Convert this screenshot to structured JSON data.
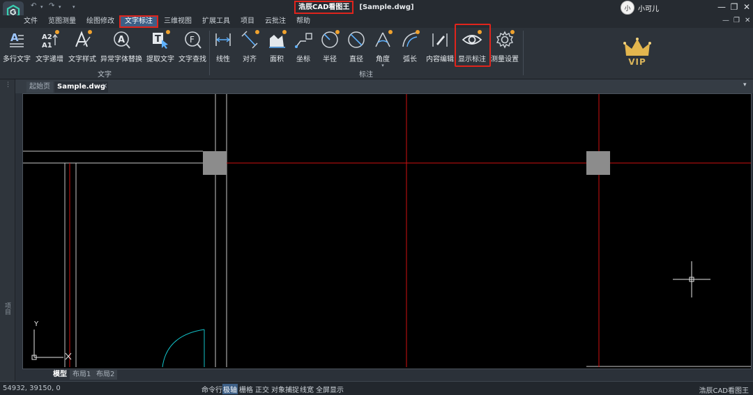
{
  "titlebar": {
    "app_title": "浩辰CAD看图王",
    "doc_title": "[Sample.dwg]",
    "user_name": "小可儿",
    "avatar_text": "小",
    "qa_undo": "↶",
    "qa_redo": "↷",
    "qa_more": "▾",
    "win_min": "—",
    "win_restore": "❐",
    "win_close": "✕"
  },
  "menu": {
    "items": [
      "文件",
      "览图测量",
      "绘图修改",
      "文字标注",
      "三维视图",
      "扩展工具",
      "项目",
      "云批注",
      "帮助"
    ],
    "sub_min": "—",
    "sub_restore": "❐",
    "sub_close": "✕"
  },
  "ribbon": {
    "text_group_label": "文字",
    "dim_group_label": "标注",
    "text_tools": [
      "多行文字",
      "文字递增",
      "文字样式",
      "异常字体替换",
      "提取文字",
      "文字查找"
    ],
    "dim_tools": [
      "线性",
      "对齐",
      "面积",
      "坐标",
      "半径",
      "直径",
      "角度",
      "弧长",
      "内容编辑",
      "显示标注",
      "测量设置"
    ],
    "vip_text": "VIP"
  },
  "tabs": {
    "home": "起始页",
    "file": "Sample.dwg",
    "close": "×",
    "expand": "▾"
  },
  "left_panel_label": "项目",
  "layouts": [
    "模型",
    "布局1",
    "布局2"
  ],
  "statusbar": {
    "coords": "54932, 39150, 0",
    "toggles": [
      "命令行",
      "极轴",
      "栅格",
      "正交",
      "对象捕捉",
      "线宽",
      "全屏显示"
    ],
    "active_toggle": "极轴",
    "brand": "浩辰CAD看图王"
  },
  "ucs": {
    "y_label": "Y"
  },
  "colors": {
    "accent_red": "#e0241c",
    "active_blue": "#3d5f86",
    "canvas": "#000000",
    "wall_line": "#c8c8c8",
    "axis_line": "#d01010",
    "door_arc": "#12c2c9"
  }
}
